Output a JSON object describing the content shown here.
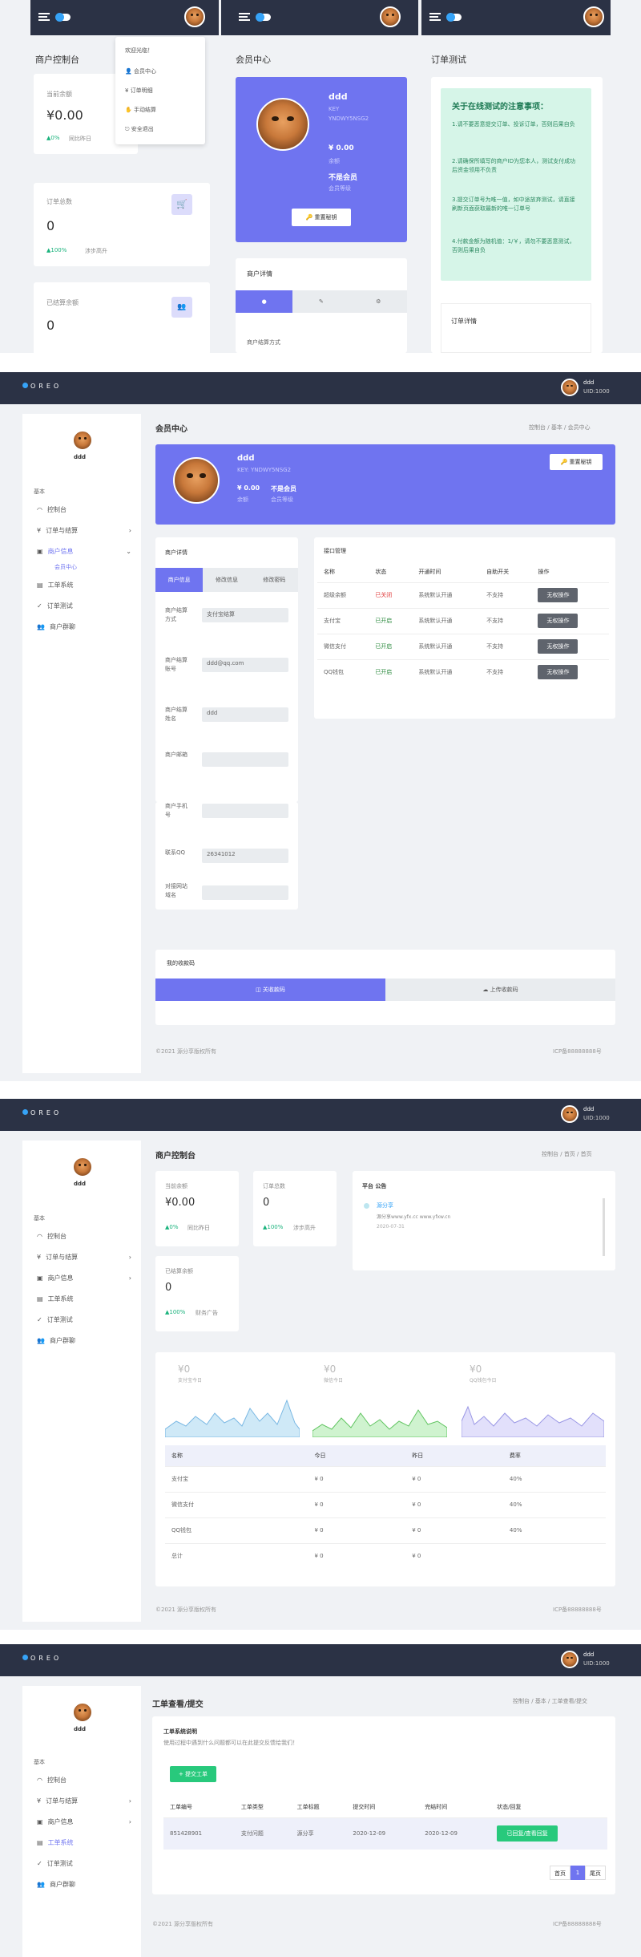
{
  "colors": {
    "topbar": "#2b3245",
    "accent": "#6f74f0",
    "green": "#28c97c",
    "mint": "#d6f5e8",
    "page": "#f0f2f5"
  },
  "user": {
    "name": "ddd",
    "uid": "UID:1000"
  },
  "brand": "OREO",
  "mobile": {
    "dashboard_title": "商户控制台",
    "balance_label": "当前余额",
    "balance": "¥0.00",
    "balance_change": "0%",
    "balance_compare": "同比昨日",
    "orders_label": "订单总数",
    "orders": "0",
    "orders_change": "100%",
    "orders_compare": "涉步高升",
    "settled_label": "已结算余额",
    "settled": "0",
    "dropdown": {
      "greeting": "欢迎光临！",
      "items": [
        "会员中心",
        "订单明细",
        "手动结算",
        "安全退出"
      ]
    },
    "member_title": "会员中心",
    "member_name": "ddd",
    "member_key_label": "KEY",
    "member_key": "YNDWY5NSG2",
    "member_balance": "¥ 0.00",
    "member_balance_label": "余额",
    "member_vip": "不是会员",
    "member_vip_label": "会员等级",
    "reset_key": "重置秘钥",
    "merchant_detail": "商户详情",
    "settle_method": "商户结算方式",
    "test_title": "订单测试",
    "notice_title": "关于在线测试的注意事项：",
    "notice_items": [
      "1.请不要恶意提交订单、投诉订单，否则后果自负",
      "2.请确保所填写的商户ID为您本人，测试支付成功后资金领用不负责",
      "3.提交订单号为唯一值，如中途放弃测试，请直接刷新页面获取最新的唯一订单号",
      "4.付款金额为随机值：1/￥，请勿不要恶意测试，否则后果自负"
    ],
    "order_detail": "订单详情"
  },
  "s2": {
    "title": "会员中心",
    "crumbs": [
      "控制台",
      "基本",
      "会员中心"
    ],
    "name": "ddd",
    "key": "KEY: YNDWY5NSG2",
    "balance": "¥ 0.00",
    "balance_label": "余额",
    "vip": "不是会员",
    "vip_label": "会员等级",
    "reset": "重置秘钥",
    "detail_title": "商户详情",
    "tabs": [
      "商户信息",
      "修改信息",
      "修改密码"
    ],
    "fields": [
      {
        "label": "商户结算方式",
        "value": "支付宝结算"
      },
      {
        "label": "商户结算账号",
        "value": "ddd@qq.com"
      },
      {
        "label": "商户结算姓名",
        "value": "ddd"
      },
      {
        "label": "商户邮箱",
        "value": ""
      },
      {
        "label": "商户手机号",
        "value": ""
      },
      {
        "label": "联系QQ",
        "value": "26341012"
      },
      {
        "label": "对接网站域名",
        "value": ""
      }
    ],
    "api_title": "接口管理",
    "api_headers": [
      "名称",
      "状态",
      "开通时间",
      "自助开关",
      "操作"
    ],
    "api_rows": [
      {
        "name": "超级余额",
        "status": "已关闭",
        "time": "系统默认开通",
        "switch": "不支持",
        "op": "无权操作"
      },
      {
        "name": "支付宝",
        "status": "已开启",
        "time": "系统默认开通",
        "switch": "不支持",
        "op": "无权操作"
      },
      {
        "name": "微信支付",
        "status": "已开启",
        "time": "系统默认开通",
        "switch": "不支持",
        "op": "无权操作"
      },
      {
        "name": "QQ钱包",
        "status": "已开启",
        "time": "系统默认开通",
        "switch": "不支持",
        "op": "无权操作"
      }
    ],
    "qr_title": "我的收款码",
    "qr_tabs": [
      "关收款码",
      "上传收款码"
    ]
  },
  "sidebar": {
    "section": "基本",
    "items": [
      "控制台",
      "订单与结算",
      "商户信息",
      "工单系统",
      "订单测试",
      "商户群聊"
    ],
    "sub_member": "会员中心"
  },
  "footer": {
    "copyright": "©2021 源分享版权所有",
    "icp": "ICP备88888888号"
  },
  "s3": {
    "title": "商户控制台",
    "crumbs": [
      "控制台",
      "首页",
      "首页"
    ],
    "balance_label": "当前余额",
    "balance": "¥0.00",
    "balance_change": "0%",
    "balance_compare": "同比昨日",
    "orders_label": "订单总数",
    "orders": "0",
    "orders_change": "100%",
    "orders_compare": "涉步高升",
    "settled_label": "已结算余额",
    "settled": "0",
    "settled_change": "100%",
    "settled_compare": "财务广告",
    "notice_title": "平台 公告",
    "notice_item": "源分享",
    "notice_text": "源分享www.yfx.cc www.yfxw.cn",
    "notice_date": "2020-07-31",
    "charts": [
      {
        "value": "¥0",
        "label": "支付宝今日"
      },
      {
        "value": "¥0",
        "label": "微信今日"
      },
      {
        "value": "¥0",
        "label": "QQ钱包今日"
      }
    ],
    "tbl_headers": [
      "名称",
      "今日",
      "昨日",
      "费率"
    ],
    "tbl_rows": [
      [
        "支付宝",
        "¥ 0",
        "¥ 0",
        "40%"
      ],
      [
        "微信支付",
        "¥ 0",
        "¥ 0",
        "40%"
      ],
      [
        "QQ钱包",
        "¥ 0",
        "¥ 0",
        "40%"
      ],
      [
        "总计",
        "¥ 0",
        "¥ 0",
        ""
      ]
    ]
  },
  "s4": {
    "title": "工单查看/提交",
    "crumbs": [
      "控制台",
      "基本",
      "工单查看/提交"
    ],
    "desc_title": "工单系统说明",
    "desc": "使用过程中遇到什么问题都可以在此提交反馈给我们！",
    "submit": "提交工单",
    "headers": [
      "工单编号",
      "工单类型",
      "工单标题",
      "提交时间",
      "完结时间",
      "状态/回复"
    ],
    "row": {
      "id": "851428901",
      "type": "支付问题",
      "title": "源分享",
      "submit": "2020-12-09",
      "finish": "2020-12-09",
      "status": "已回复/查看回复"
    },
    "pager": [
      "首页",
      "1",
      "尾页"
    ]
  }
}
